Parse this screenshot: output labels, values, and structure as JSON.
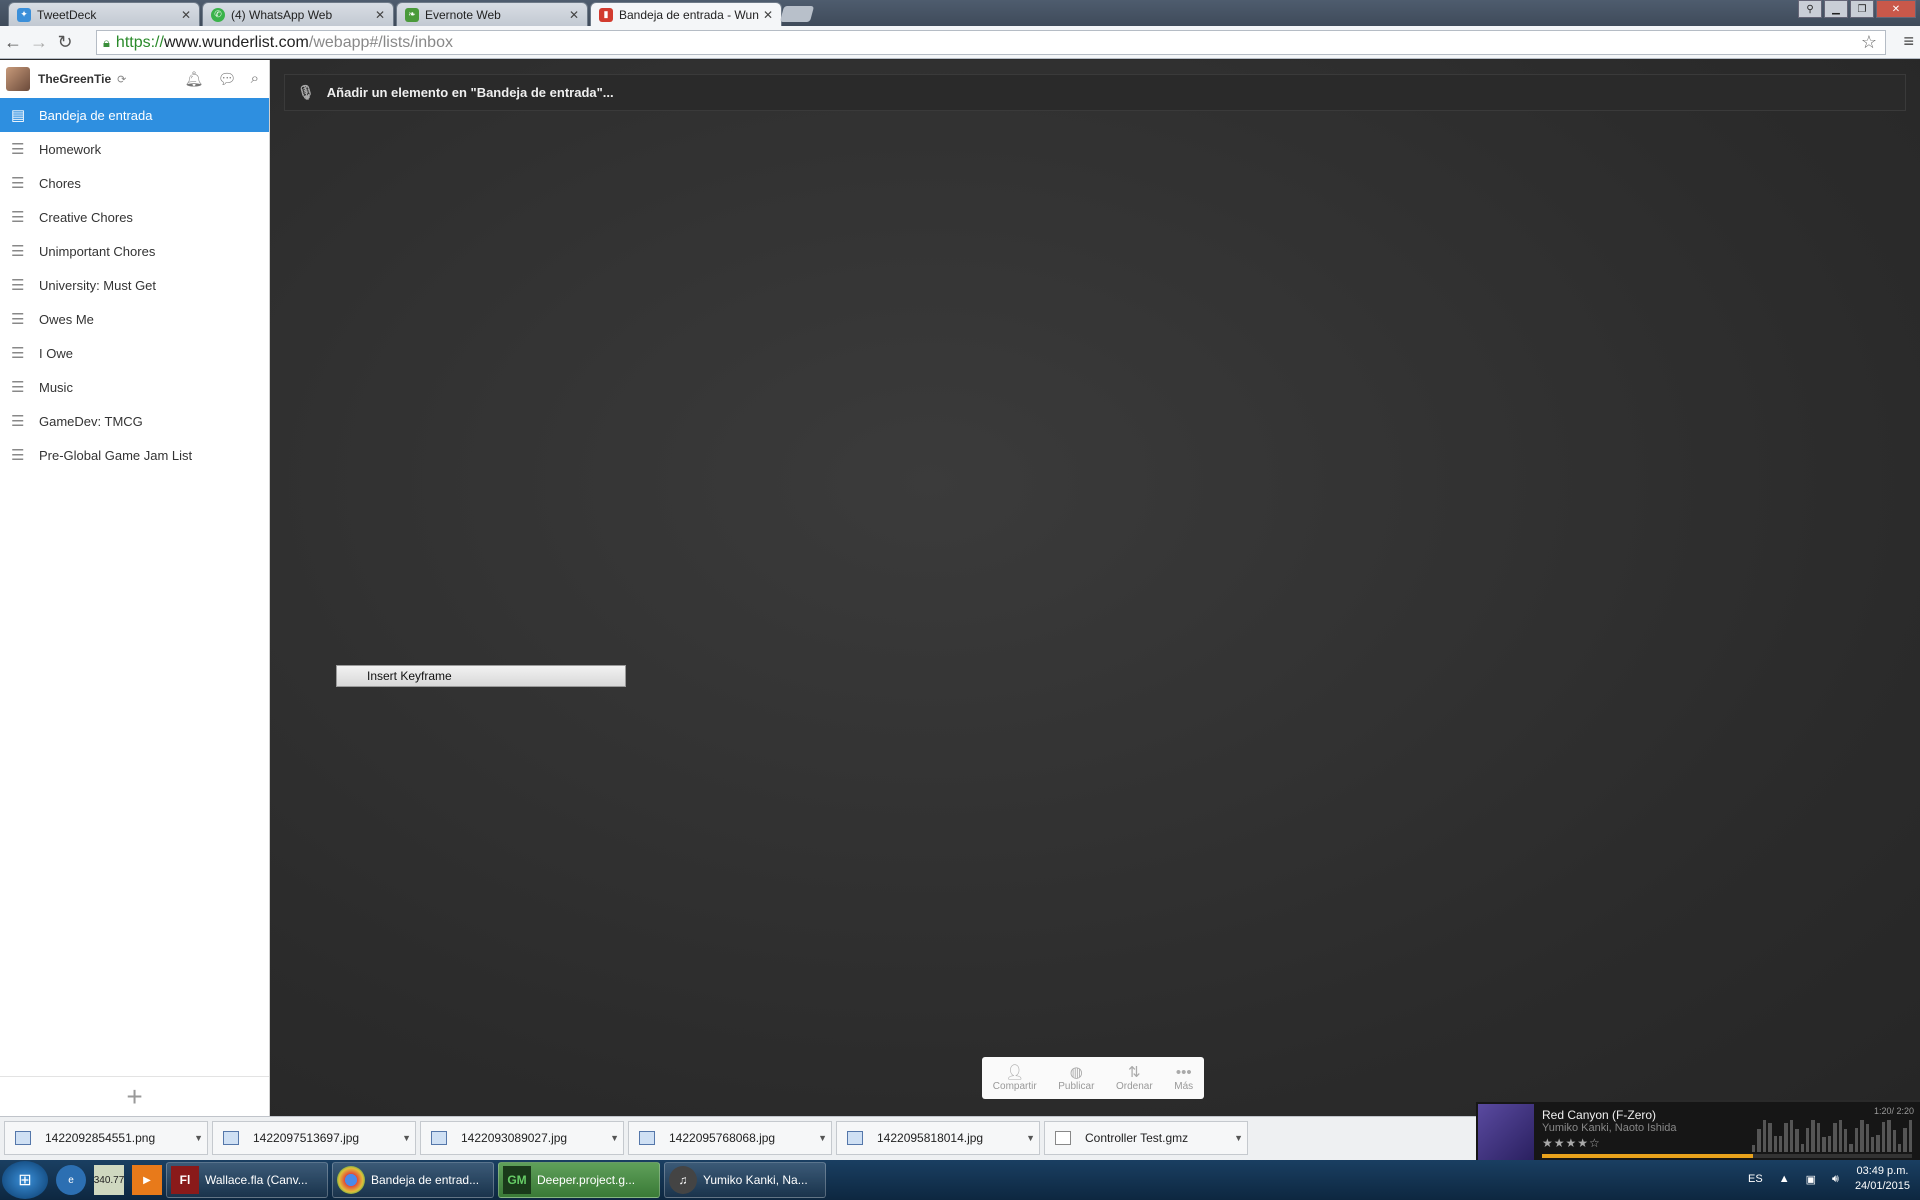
{
  "tabs": [
    {
      "label": "TweetDeck",
      "icon": "tweetdeck-icon",
      "color": "#3b8fd9"
    },
    {
      "label": "(4) WhatsApp Web",
      "icon": "whatsapp-icon",
      "color": "#3ab34a"
    },
    {
      "label": "Evernote Web",
      "icon": "evernote-icon",
      "color": "#4a9a3a"
    },
    {
      "label": "Bandeja de entrada - Wun",
      "icon": "wunderlist-icon",
      "color": "#d23b2f"
    }
  ],
  "url": {
    "scheme": "https://",
    "host": "www.wunderlist.com",
    "path": "/webapp#/lists/inbox"
  },
  "user": {
    "name": "TheGreenTie"
  },
  "lists": [
    {
      "label": "Bandeja de entrada",
      "active": true
    },
    {
      "label": "Homework"
    },
    {
      "label": "Chores"
    },
    {
      "label": "Creative Chores"
    },
    {
      "label": "Unimportant Chores"
    },
    {
      "label": "University: Must Get"
    },
    {
      "label": "Owes Me"
    },
    {
      "label": "I Owe"
    },
    {
      "label": "Music"
    },
    {
      "label": "GameDev: TMCG"
    },
    {
      "label": "Pre-Global Game Jam List"
    }
  ],
  "add_item": {
    "placeholder": "Añadir un elemento en \"Bandeja de entrada\"..."
  },
  "context_menu": {
    "item": "Insert Keyframe"
  },
  "actions": [
    {
      "label": "Compartir",
      "icon": "add-person-icon"
    },
    {
      "label": "Publicar",
      "icon": "globe-icon"
    },
    {
      "label": "Ordenar",
      "icon": "sort-icon"
    },
    {
      "label": "Más",
      "icon": "more-icon"
    }
  ],
  "downloads": [
    "1422092854551.png",
    "1422097513697.jpg",
    "1422093089027.jpg",
    "1422095768068.jpg",
    "1422095818014.jpg",
    "Controller Test.gmz"
  ],
  "music": {
    "title": "Red Canyon (F-Zero)",
    "artist": "Yumiko Kanki, Naoto Ishida",
    "time": "1:20/ 2:20",
    "progress": 0.57
  },
  "taskbar": {
    "quick_label": "340.77",
    "tasks": [
      {
        "label": "Wallace.fla (Canv...",
        "icon": "flash-icon"
      },
      {
        "label": "Bandeja de entrad...",
        "icon": "chrome-icon"
      },
      {
        "label": "Deeper.project.g...",
        "icon": "gamemaker-icon"
      },
      {
        "label": "Yumiko Kanki, Na...",
        "icon": "music-player-icon"
      }
    ],
    "language": "ES",
    "time": "03:49 p.m.",
    "date": "24/01/2015"
  }
}
